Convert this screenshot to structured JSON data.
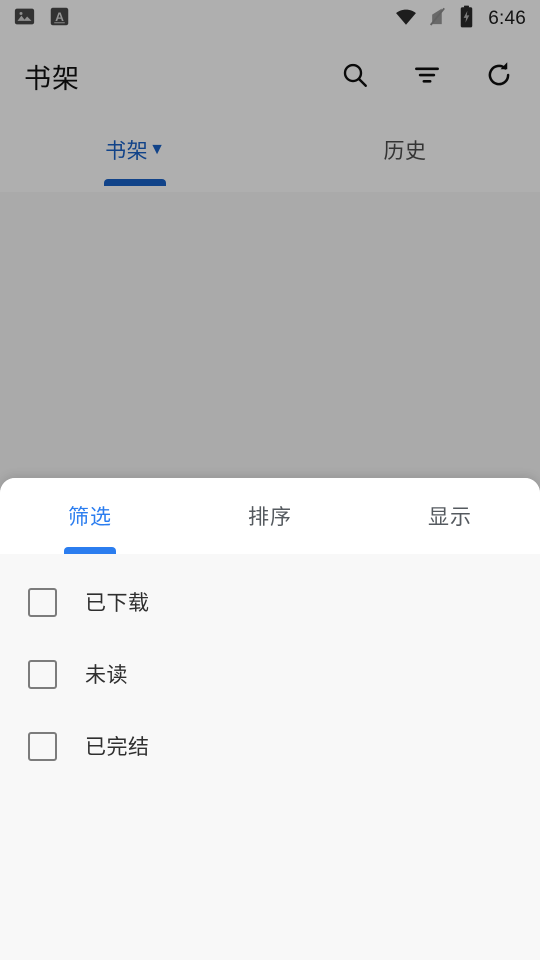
{
  "status_bar": {
    "icons_left": [
      "image-icon",
      "font-a-icon"
    ],
    "icons_right": [
      "wifi-icon",
      "signal-off-icon",
      "battery-charging-icon"
    ],
    "time": "6:46"
  },
  "app_bar": {
    "title": "书架",
    "actions": [
      {
        "name": "search-button",
        "icon": "search-icon"
      },
      {
        "name": "filter-button",
        "icon": "filter-list-icon"
      },
      {
        "name": "refresh-button",
        "icon": "refresh-icon"
      }
    ]
  },
  "top_tabs": {
    "items": [
      {
        "label": "书架",
        "caret": "▼",
        "active": true
      },
      {
        "label": "历史",
        "caret": "",
        "active": false
      }
    ]
  },
  "bottom_sheet": {
    "tabs": [
      {
        "label": "筛选",
        "active": true
      },
      {
        "label": "排序",
        "active": false
      },
      {
        "label": "显示",
        "active": false
      }
    ],
    "filters": [
      {
        "label": "已下载",
        "checked": false
      },
      {
        "label": "未读",
        "checked": false
      },
      {
        "label": "已完结",
        "checked": false
      }
    ]
  },
  "colors": {
    "accent_top_tab": "#1a62c8",
    "accent_sheet_tab": "#2b7def",
    "sheet_bg": "#f8f8f8",
    "sheet_tabbar_bg": "#ffffff",
    "text_primary": "#2f2f2f",
    "text_muted": "#555a5f",
    "checkbox_border": "#7c7c7c"
  }
}
